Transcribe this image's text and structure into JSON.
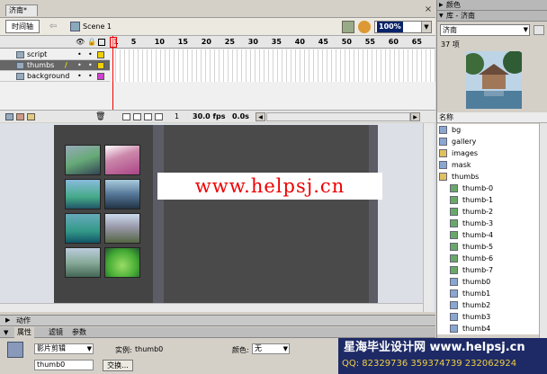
{
  "document": {
    "tab_label": "济南*",
    "timeline_button": "时间轴",
    "scene_label": "Scene 1",
    "zoom": "100%"
  },
  "timeline": {
    "ruler": [
      "1",
      "5",
      "10",
      "15",
      "20",
      "25",
      "30",
      "35",
      "40",
      "45",
      "50",
      "55",
      "60",
      "65"
    ],
    "layers": [
      {
        "name": "script",
        "selected": false,
        "color": "#f0d000"
      },
      {
        "name": "thumbs",
        "selected": true,
        "color": "#f0d000"
      },
      {
        "name": "background",
        "selected": false,
        "color": "#d040d0"
      }
    ],
    "current_frame": "1",
    "fps": "30.0 fps",
    "time": "0.0s"
  },
  "stage": {
    "watermark": "www.helpsj.cn"
  },
  "panels": {
    "actions_label": "动作",
    "props_tabs": [
      "属性",
      "滤镜",
      "参数"
    ],
    "symbol_type": "影片剪辑",
    "instance_name": "thumb0",
    "instance_label": "实例:",
    "instance_value": "thumb0",
    "swap_label": "交换...",
    "color_label": "颜色:",
    "color_value": "无"
  },
  "right": {
    "color_panel": "颜色",
    "library_panel": "库 - 济南",
    "library_select": "济南",
    "item_count": "37 项",
    "column_header": "名称",
    "items": [
      {
        "name": "bg",
        "kind": "symbol",
        "indent": false
      },
      {
        "name": "gallery",
        "kind": "symbol",
        "indent": false
      },
      {
        "name": "images",
        "kind": "folder",
        "indent": false
      },
      {
        "name": "mask",
        "kind": "symbol",
        "indent": false
      },
      {
        "name": "thumbs",
        "kind": "folder",
        "indent": false
      },
      {
        "name": "thumb-0",
        "kind": "bitmap",
        "indent": true
      },
      {
        "name": "thumb-1",
        "kind": "bitmap",
        "indent": true
      },
      {
        "name": "thumb-2",
        "kind": "bitmap",
        "indent": true
      },
      {
        "name": "thumb-3",
        "kind": "bitmap",
        "indent": true
      },
      {
        "name": "thumb-4",
        "kind": "bitmap",
        "indent": true
      },
      {
        "name": "thumb-5",
        "kind": "bitmap",
        "indent": true
      },
      {
        "name": "thumb-6",
        "kind": "bitmap",
        "indent": true
      },
      {
        "name": "thumb-7",
        "kind": "bitmap",
        "indent": true
      },
      {
        "name": "thumb0",
        "kind": "symbol",
        "indent": true
      },
      {
        "name": "thumb1",
        "kind": "symbol",
        "indent": true
      },
      {
        "name": "thumb2",
        "kind": "symbol",
        "indent": true
      },
      {
        "name": "thumb3",
        "kind": "symbol",
        "indent": true
      },
      {
        "name": "thumb4",
        "kind": "symbol",
        "indent": true
      }
    ]
  },
  "banner": {
    "line1": "星海毕业设计网 www.helpsj.cn",
    "line2": "QQ: 82329736  359374739  232062924"
  }
}
